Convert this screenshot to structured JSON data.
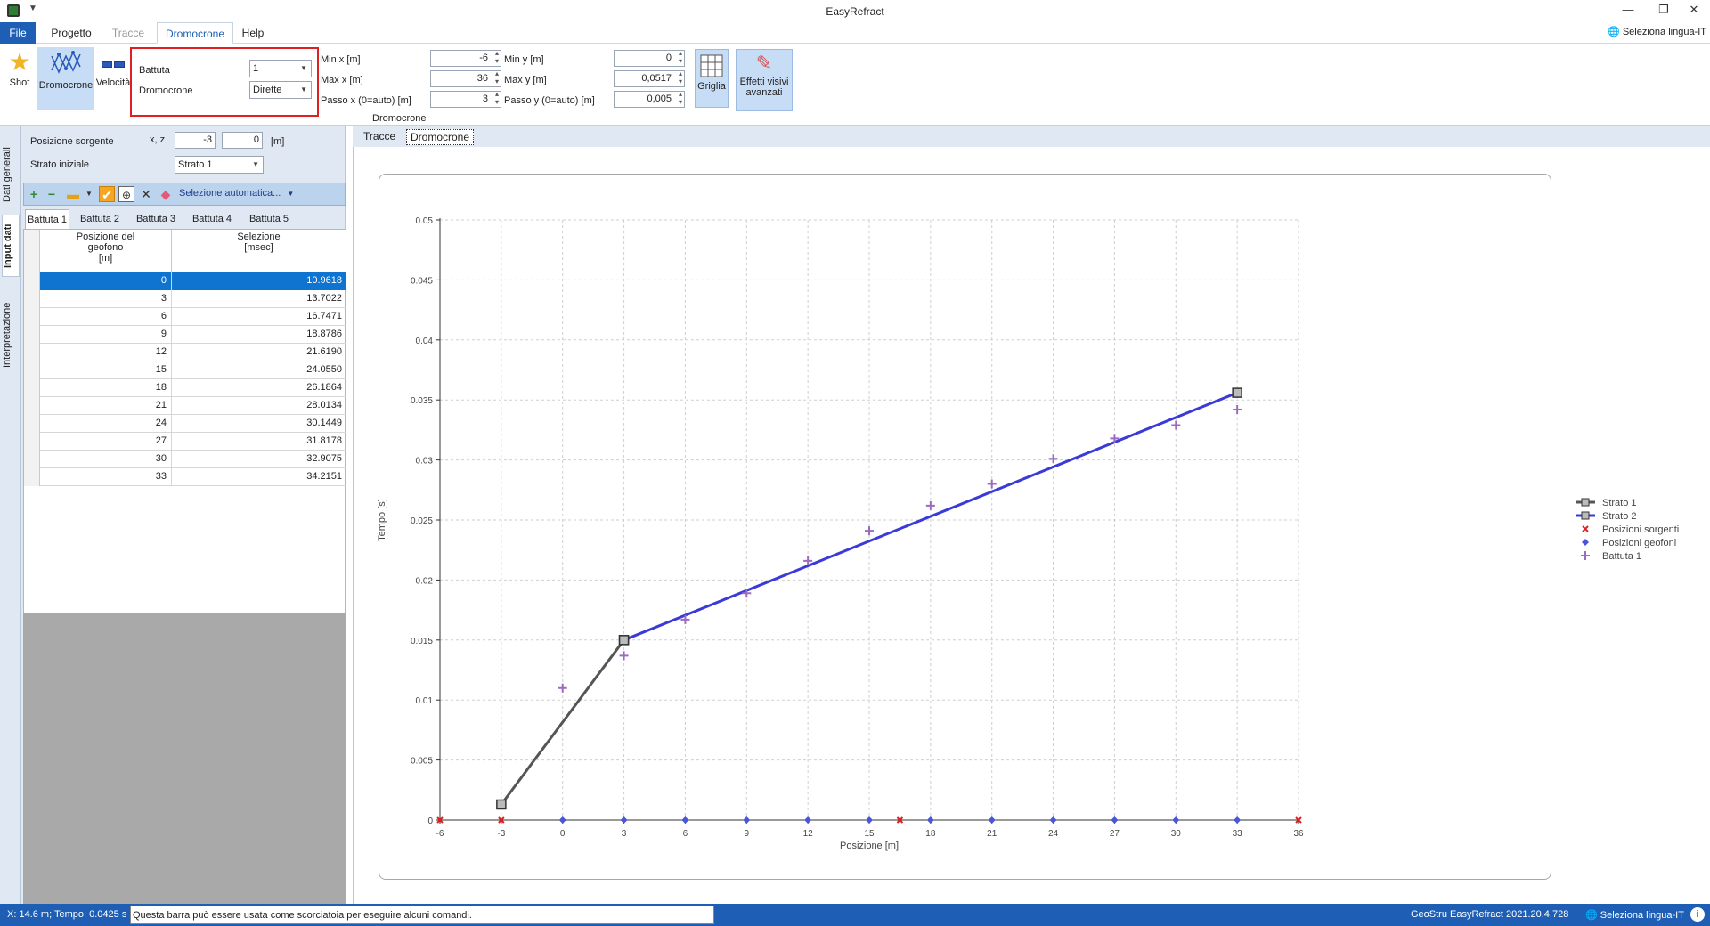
{
  "app": {
    "title": "EasyRefract",
    "lang_label": "Seleziona lingua-IT"
  },
  "ribbon_tabs": [
    "File",
    "Progetto",
    "Tracce",
    "Dromocrone",
    "Help"
  ],
  "ribbon": {
    "shot_label": "Shot",
    "dromocrone_label": "Dromocrone",
    "velocita_label": "Velocità",
    "battuta_label": "Battuta",
    "battuta_value": "1",
    "dromocrone_combo_label": "Dromocrone",
    "dromocrone_combo_value": "Dirette",
    "min_x_label": "Min x [m]",
    "min_x_value": "-6",
    "max_x_label": "Max x [m]",
    "max_x_value": "36",
    "passo_x_label": "Passo x (0=auto) [m]",
    "passo_x_value": "3",
    "min_y_label": "Min y [m]",
    "min_y_value": "0",
    "max_y_label": "Max y [m]",
    "max_y_value": "0,0517",
    "passo_y_label": "Passo y (0=auto) [m]",
    "passo_y_value": "0,005",
    "griglia_label": "Griglia",
    "effetti_label_1": "Effetti visivi",
    "effetti_label_2": "avanzati",
    "group_caption": "Dromocrone"
  },
  "vertical_tabs": [
    "Dati generali",
    "Input dati",
    "Interpretazione"
  ],
  "left": {
    "posizione_label": "Posizione sorgente",
    "xz_label": "x, z",
    "x_value": "-3",
    "z_value": "0",
    "unit_label": "[m]",
    "strato_label": "Strato iniziale",
    "strato_value": "Strato 1",
    "auto_select_label": "Selezione automatica...",
    "battute": [
      "Battuta 1",
      "Battuta 2",
      "Battuta 3",
      "Battuta 4",
      "Battuta 5"
    ],
    "col1_line1": "Posizione del",
    "col1_line2": "geofono",
    "col1_line3": "[m]",
    "col2_line1": "Selezione",
    "col2_line2": "[msec]",
    "rows": [
      {
        "pos": "0",
        "sel": "10.9618"
      },
      {
        "pos": "3",
        "sel": "13.7022"
      },
      {
        "pos": "6",
        "sel": "16.7471"
      },
      {
        "pos": "9",
        "sel": "18.8786"
      },
      {
        "pos": "12",
        "sel": "21.6190"
      },
      {
        "pos": "15",
        "sel": "24.0550"
      },
      {
        "pos": "18",
        "sel": "26.1864"
      },
      {
        "pos": "21",
        "sel": "28.0134"
      },
      {
        "pos": "24",
        "sel": "30.1449"
      },
      {
        "pos": "27",
        "sel": "31.8178"
      },
      {
        "pos": "30",
        "sel": "32.9075"
      },
      {
        "pos": "33",
        "sel": "34.2151"
      }
    ]
  },
  "right_tabs": [
    "Tracce",
    "Dromocrone"
  ],
  "chart_data": {
    "type": "line",
    "title": "",
    "xlabel": "Posizione [m]",
    "ylabel": "Tempo [s]",
    "xlim": [
      -6,
      36
    ],
    "ylim": [
      0,
      0.05
    ],
    "x_ticks": [
      "-6",
      "-3",
      "0",
      "3",
      "6",
      "9",
      "12",
      "15",
      "18",
      "21",
      "24",
      "27",
      "30",
      "33",
      "36"
    ],
    "y_ticks": [
      "0",
      "0.005",
      "0.01",
      "0.015",
      "0.02",
      "0.025",
      "0.03",
      "0.035",
      "0.04",
      "0.045",
      "0.05"
    ],
    "grid": true,
    "legend_position": "right",
    "series": [
      {
        "name": "Strato 1",
        "kind": "line",
        "color": "#555555",
        "x": [
          -3,
          3
        ],
        "y": [
          0.0013,
          0.015
        ]
      },
      {
        "name": "Strato 2",
        "kind": "line",
        "color": "#3a3ad8",
        "x": [
          3,
          33
        ],
        "y": [
          0.015,
          0.0356
        ]
      },
      {
        "name": "Posizioni sorgenti",
        "kind": "marker",
        "color": "#e02020",
        "x": [
          -6,
          -3,
          16.5,
          36
        ],
        "y": [
          0,
          0,
          0,
          0
        ]
      },
      {
        "name": "Posizioni geofoni",
        "kind": "marker",
        "color": "#4a55d8",
        "x": [
          0,
          3,
          6,
          9,
          12,
          15,
          18,
          21,
          24,
          27,
          30,
          33
        ],
        "y": [
          0,
          0,
          0,
          0,
          0,
          0,
          0,
          0,
          0,
          0,
          0,
          0
        ]
      },
      {
        "name": "Battuta 1",
        "kind": "marker",
        "color": "#9a6bc0",
        "x": [
          0,
          3,
          6,
          9,
          12,
          15,
          18,
          21,
          24,
          27,
          30,
          33
        ],
        "y": [
          0.011,
          0.0137,
          0.0167,
          0.0189,
          0.0216,
          0.0241,
          0.0262,
          0.028,
          0.0301,
          0.0318,
          0.0329,
          0.0342
        ]
      }
    ]
  },
  "status": {
    "coords": "X: 14.6 m; Tempo: 0.0425 s",
    "cmd_hint": "Questa barra può essere usata come scorciatoia per eseguire alcuni comandi.",
    "version": "GeoStru EasyRefract 2021.20.4.728",
    "lang": "Seleziona lingua-IT",
    "info": "i"
  }
}
